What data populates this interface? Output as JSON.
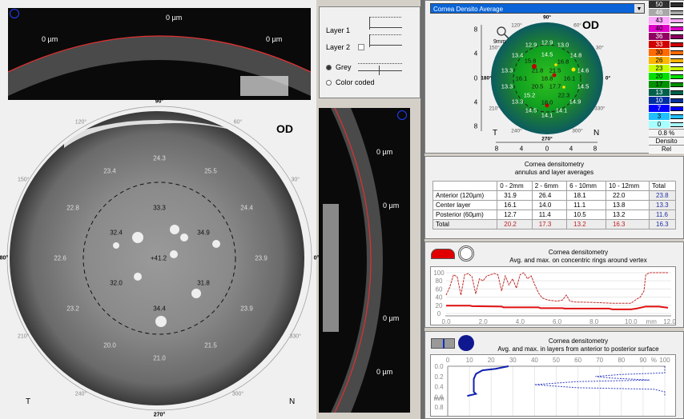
{
  "scheimpflug_top": {
    "labels": [
      "0 µm",
      "0 µm",
      "0 µm"
    ]
  },
  "scheimpflug_vertical": {
    "labels": [
      "0 µm",
      "0 µm",
      "0 µm",
      "0 µm"
    ]
  },
  "layer_controls": {
    "layer1": "Layer 1",
    "layer2": "Layer 2",
    "grey": "Grey",
    "color_coded": "Color coded",
    "selected_mode": "Grey",
    "layer2_checked": false
  },
  "big_map": {
    "eye": "OD",
    "temporal": "T",
    "nasal": "N",
    "degrees": [
      "90°",
      "60°",
      "30°",
      "0°",
      "330°",
      "300°",
      "270°",
      "240°",
      "210°",
      "180°",
      "150°",
      "120°"
    ],
    "values": [
      "24.3",
      "23.4",
      "25.5",
      "22.8",
      "33.3",
      "24.4",
      "32.4",
      "34.9",
      "22.6",
      "+41.2",
      "23.9",
      "32.0",
      "31.8",
      "23.2",
      "34.4",
      "23.9",
      "20.0",
      "21.5",
      "21.0"
    ]
  },
  "color_map": {
    "dropdown": "Cornea Densito Average",
    "eye": "OD",
    "zoom_label": "9mm",
    "temporal": "T",
    "nasal": "N",
    "degrees": [
      "90°",
      "60°",
      "30°",
      "0°",
      "330°",
      "300°",
      "270°",
      "240°",
      "210°",
      "180°",
      "150°",
      "120°"
    ],
    "y_ticks": [
      "8",
      "4",
      "0",
      "4",
      "8"
    ],
    "x_ticks": [
      "8",
      "4",
      "0",
      "4",
      "8"
    ],
    "values": [
      "12.9",
      "12.9",
      "13.0",
      "13.4",
      "14.5",
      "16.8",
      "14.8",
      "15.8",
      "13.3",
      "21.8",
      "21.5",
      "14.6",
      "16.1",
      "18.8",
      "16.1",
      "13.3",
      "20.5",
      "17.7",
      "14.5",
      "15.2",
      "22.3",
      "13.3",
      "18.0",
      "14.9",
      "14.5",
      "14.1",
      "14.1"
    ]
  },
  "color_scale": {
    "levels": [
      {
        "v": "50",
        "c": "#303030"
      },
      {
        "v": "46",
        "c": "#a8a8a8"
      },
      {
        "v": "43",
        "c": "#ffa8ff"
      },
      {
        "v": "40",
        "c": "#e000c8"
      },
      {
        "v": "36",
        "c": "#900060"
      },
      {
        "v": "33",
        "c": "#d00000"
      },
      {
        "v": "30",
        "c": "#ff6a00"
      },
      {
        "v": "26",
        "c": "#ffb400"
      },
      {
        "v": "23",
        "c": "#c8ff00"
      },
      {
        "v": "20",
        "c": "#00e000"
      },
      {
        "v": "17",
        "c": "#009000"
      },
      {
        "v": "13",
        "c": "#00604c"
      },
      {
        "v": "10",
        "c": "#0030a0"
      },
      {
        "v": "7",
        "c": "#0000ff"
      },
      {
        "v": "3",
        "c": "#20c0ff"
      },
      {
        "v": "0",
        "c": "#a8ffff"
      }
    ],
    "step": "0.8 %",
    "mode": "Densito",
    "rel": "Rel"
  },
  "table": {
    "title1": "Cornea densitometry",
    "title2": "annulus and layer averages",
    "headers": [
      "",
      "0 - 2mm",
      "2 - 6mm",
      "6 - 10mm",
      "10 - 12mm",
      "Total"
    ],
    "rows": [
      [
        "Anterior (120µm)",
        "31.9",
        "26.4",
        "18.1",
        "22.0",
        "23.8"
      ],
      [
        "Center layer",
        "16.1",
        "14.0",
        "11.1",
        "13.8",
        "13.3"
      ],
      [
        "Posterior (60µm)",
        "12.7",
        "11.4",
        "10.5",
        "13.2",
        "11.6"
      ],
      [
        "Total",
        "20.2",
        "17.3",
        "13.2",
        "16.3",
        "16.3"
      ]
    ]
  },
  "chart_data": [
    {
      "type": "line",
      "title": "Cornea densitometry",
      "subtitle": "Avg. and max. on concentric rings around vertex",
      "xlabel": "mm",
      "xlim": [
        0,
        12
      ],
      "ylim": [
        0,
        100
      ],
      "x_ticks": [
        "0.0",
        "2.0",
        "4.0",
        "6.0",
        "8.0",
        "10.0",
        "12.0"
      ],
      "y_ticks": [
        "0",
        "20",
        "40",
        "60",
        "80",
        "100"
      ],
      "ylabel": "%",
      "series": [
        {
          "style": "dashed",
          "color": "#c03030",
          "x": [
            0,
            0.2,
            0.4,
            0.6,
            0.8,
            1.0,
            1.2,
            1.4,
            1.6,
            1.8,
            2.0,
            2.2,
            2.4,
            2.6,
            2.8,
            3.0,
            3.2,
            3.4,
            3.6,
            3.8,
            4.0,
            4.2,
            4.4,
            4.6,
            4.8,
            5.0,
            5.2,
            5.5,
            6.0,
            6.3,
            6.5,
            6.7,
            7.0,
            8.0,
            9.0,
            10.0,
            10.3,
            10.5,
            10.7,
            10.8,
            11.0,
            12.0
          ],
          "y": [
            45,
            65,
            95,
            90,
            45,
            95,
            98,
            90,
            48,
            85,
            80,
            92,
            95,
            98,
            95,
            55,
            92,
            70,
            85,
            62,
            95,
            100,
            85,
            92,
            70,
            50,
            38,
            33,
            30,
            33,
            45,
            30,
            28,
            27,
            25,
            25,
            35,
            40,
            55,
            95,
            100,
            100
          ]
        },
        {
          "style": "solid",
          "color": "#e01010",
          "x": [
            0,
            1.3,
            1.4,
            3.0,
            3.1,
            5.0,
            5.1,
            6.3,
            6.4,
            8.8,
            9.0,
            10.0,
            10.3,
            10.8,
            11.5,
            12.0
          ],
          "y": [
            19,
            19,
            18,
            17,
            15,
            15,
            13,
            13,
            12,
            12,
            10,
            10,
            12,
            17,
            17,
            14
          ]
        }
      ]
    },
    {
      "type": "line",
      "title": "Cornea densitometry",
      "subtitle": "Avg. and max. in layers from anterior to posterior surface",
      "xlabel": "%",
      "ylabel": "mm",
      "xlim": [
        0,
        100
      ],
      "ylim": [
        0.8,
        0.0
      ],
      "x_ticks": [
        "0",
        "10",
        "20",
        "30",
        "40",
        "50",
        "60",
        "70",
        "80",
        "90",
        "100"
      ],
      "y_ticks": [
        "0.0",
        "0.2",
        "0.4",
        "0.6",
        "0.8"
      ],
      "series": [
        {
          "style": "solid",
          "color": "#1020b0",
          "x": [
            28,
            22,
            16,
            13,
            12,
            12,
            12,
            13,
            9
          ],
          "y": [
            0.0,
            0.05,
            0.08,
            0.15,
            0.25,
            0.4,
            0.5,
            0.54,
            0.58
          ]
        },
        {
          "style": "dashed",
          "color": "#3040c0",
          "x": [
            100,
            100,
            80,
            68,
            75,
            93,
            60,
            40,
            60,
            95,
            100,
            100
          ],
          "y": [
            0,
            0.13,
            0.16,
            0.2,
            0.23,
            0.27,
            0.3,
            0.36,
            0.42,
            0.45,
            0.5,
            0.57
          ]
        }
      ]
    }
  ]
}
